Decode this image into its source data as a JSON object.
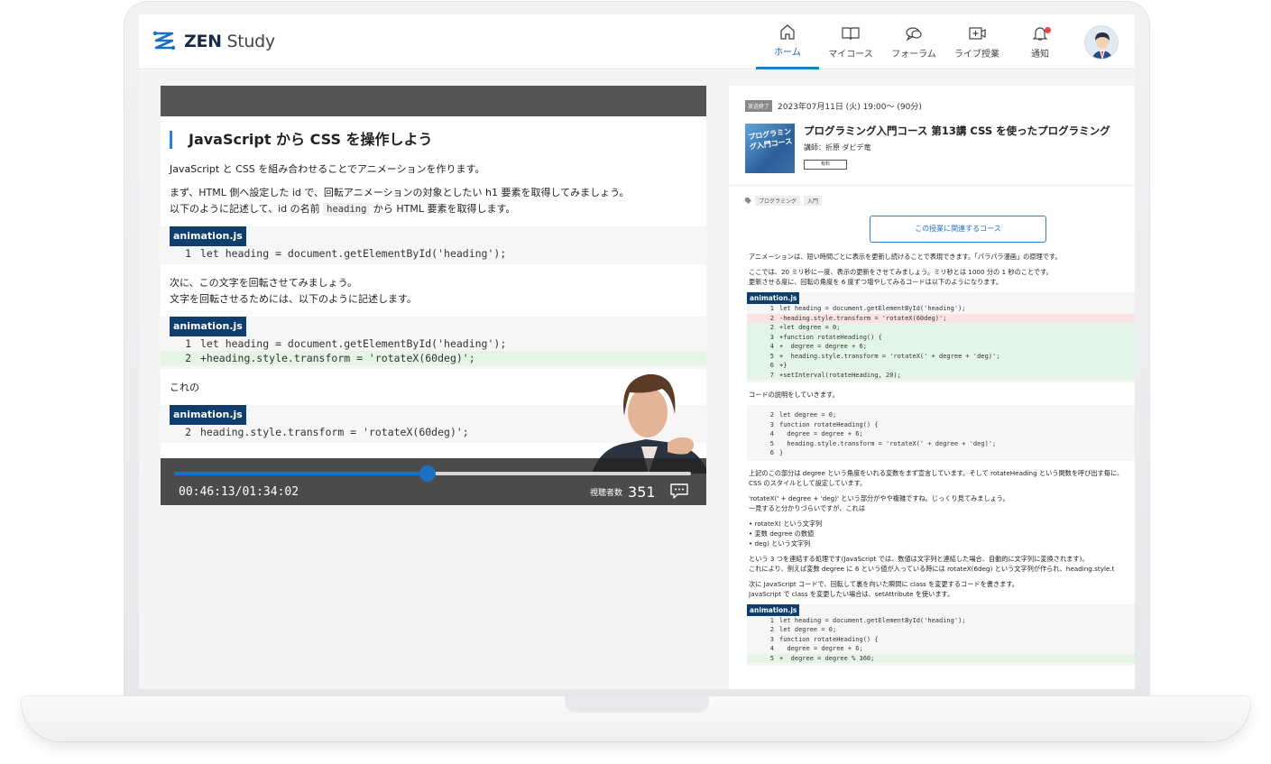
{
  "brand": {
    "logo_bold": "ZEN",
    "logo_light": " Study"
  },
  "nav": [
    {
      "label": "ホーム",
      "icon": "home-icon",
      "active": true
    },
    {
      "label": "マイコース",
      "icon": "book-icon"
    },
    {
      "label": "フォーラム",
      "icon": "forum-icon"
    },
    {
      "label": "ライブ授業",
      "icon": "live-icon"
    },
    {
      "label": "通知",
      "icon": "bell-icon"
    }
  ],
  "doc": {
    "title": "JavaScript から CSS を操作しよう",
    "p1": "JavaScript と CSS を組み合わせることでアニメーションを作ります。",
    "p2a": "まず、HTML 側へ設定した id で、回転アニメーションの対象としたい h1 要素を取得してみましょう。",
    "p2b_pre": "以下のように記述して、id の名前 ",
    "p2b_code": "heading",
    "p2b_post": " から HTML 要素を取得します。",
    "file": "animation.js",
    "p3a": "次に、この文字を回転させてみましょう。",
    "p3b": "文字を回転させるためには、以下のように記述します。",
    "p4": "これの",
    "code1": [
      {
        "n": "1",
        "t": "let heading = document.getElementById('heading');"
      }
    ],
    "code2": [
      {
        "n": "1",
        "t": "let heading = document.getElementById('heading');"
      },
      {
        "n": "2",
        "t": "+heading.style.transform = 'rotateX(60deg)';",
        "add": true
      }
    ],
    "code3": [
      {
        "n": "2",
        "t": "heading.style.transform = 'rotateX(60deg)';"
      }
    ]
  },
  "player": {
    "time": "00:46:13/01:34:02",
    "progress": 0.49,
    "viewers_label": "視聴者数",
    "viewers": "351"
  },
  "lesson": {
    "status": "放送終了",
    "date": "2023年07月11日 (火) 19:00〜 (90分)",
    "thumb_text": "プログラミング入門コース",
    "title": "プログラミング入門コース 第13講 CSS を使ったプログラミング",
    "teacher": "講師：折原 ダビデ竜",
    "paid": "有料",
    "tags": [
      "プログラミング",
      "入門"
    ],
    "related_button": "この授業に関連するコース"
  },
  "article": {
    "a1": "アニメーションは、短い時間ごとに表示を更新し続けることで表現できます。「パラパラ漫画」の原理です。",
    "a2": "ここでは、20 ミリ秒に一度、表示の更新をさせてみましょう。ミリ秒とは 1000 分の 1 秒のことです。",
    "a3": "更新させる度に、回転の角度を 6 度ずつ増やしてみるコードは以下のようになります。",
    "a4": "コードの説明をしていきます。",
    "a5": "上記のこの部分は degree という角度をいれる変数をまず宣言しています。そして rotateHeading という関数を呼び出す毎に、",
    "a6": "CSS のスタイルとして設定しています。",
    "a7": "'rotateX(' + degree + 'deg)' という部分がやや複雑ですね。じっくり見てみましょう。",
    "a8": "一見すると分かりづらいですが、これは",
    "list": [
      "rotateX( という文字列",
      "変数 degree の数値",
      "deg) という文字列"
    ],
    "a9": "という 3 つを連結する処理です(JavaScript では、数値は文字列と連結した場合、自動的に文字列に変換されます)。",
    "a10": "これにより、例えば変数 degree に 6 という値が入っている時には rotateX(6deg) という文字列が作られ、heading.style.t",
    "a11": "次に JavaScript コードで、回転して裏を向いた瞬間に class を変更するコードを書きます。",
    "a12": "JavaScript で class を変更したい場合は、setAttribute を使います。",
    "file": "animation.js",
    "mcode1": [
      {
        "n": "1",
        "t": "let heading = document.getElementById('heading');"
      },
      {
        "n": "2",
        "t": "-heading.style.transform = 'rotateX(60deg)';",
        "cls": "del"
      },
      {
        "n": "2",
        "t": "+let degree = 0;",
        "cls": "add"
      },
      {
        "n": "3",
        "t": "+function rotateHeading() {",
        "cls": "add"
      },
      {
        "n": "4",
        "t": "+  degree = degree + 6;",
        "cls": "add"
      },
      {
        "n": "5",
        "t": "+  heading.style.transform = 'rotateX(' + degree + 'deg)';",
        "cls": "add"
      },
      {
        "n": "6",
        "t": "+}",
        "cls": "add"
      },
      {
        "n": "7",
        "t": "+setInterval(rotateHeading, 20);",
        "cls": "add"
      }
    ],
    "mcode2": [
      {
        "n": "2",
        "t": "let degree = 0;"
      },
      {
        "n": "3",
        "t": "function rotateHeading() {"
      },
      {
        "n": "4",
        "t": "  degree = degree + 6;"
      },
      {
        "n": "5",
        "t": "  heading.style.transform = 'rotateX(' + degree + 'deg)';"
      },
      {
        "n": "6",
        "t": "}"
      }
    ],
    "mcode3": [
      {
        "n": "1",
        "t": "let heading = document.getElementById('heading');"
      },
      {
        "n": "2",
        "t": "let degree = 0;"
      },
      {
        "n": "3",
        "t": "function rotateHeading() {"
      },
      {
        "n": "4",
        "t": "  degree = degree + 6;"
      },
      {
        "n": "5",
        "t": "+  degree = degree % 360;",
        "cls": "add"
      }
    ]
  }
}
